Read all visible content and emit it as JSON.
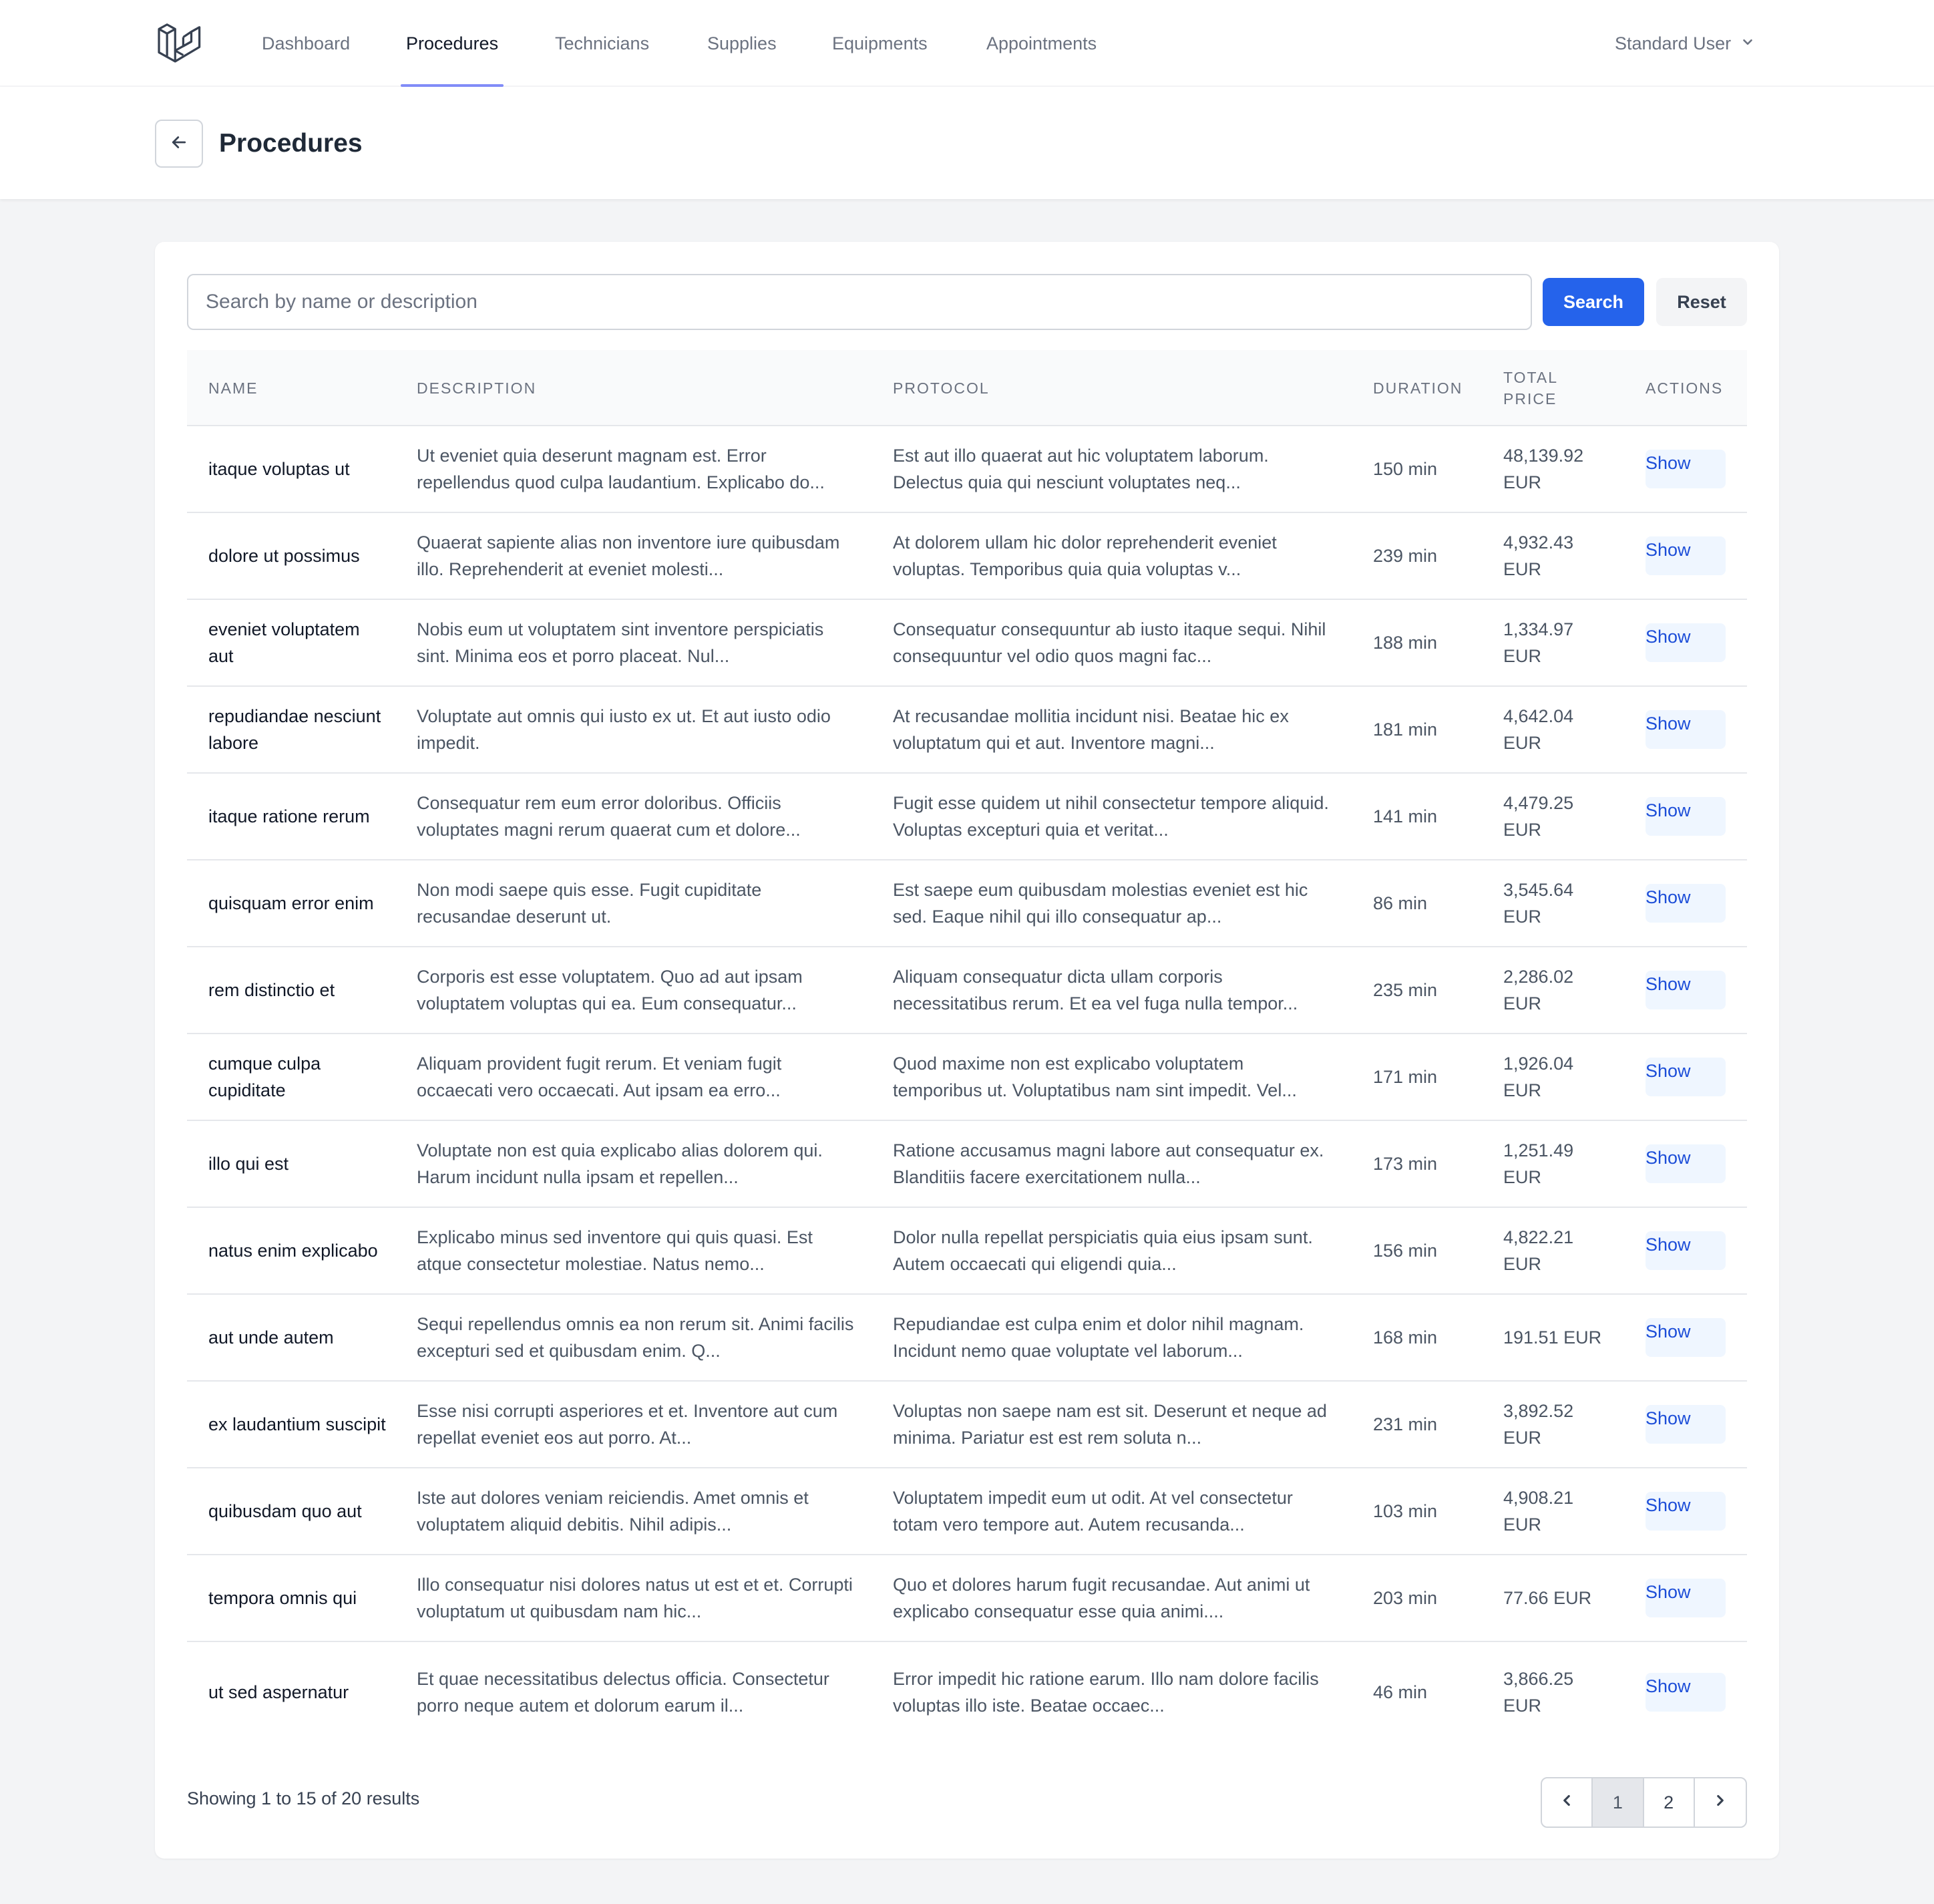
{
  "nav": {
    "items": [
      {
        "label": "Dashboard"
      },
      {
        "label": "Procedures",
        "active": true
      },
      {
        "label": "Technicians"
      },
      {
        "label": "Supplies"
      },
      {
        "label": "Equipments"
      },
      {
        "label": "Appointments"
      }
    ],
    "user_label": "Standard User"
  },
  "header": {
    "title": "Procedures"
  },
  "search": {
    "placeholder": "Search by name or description",
    "value": "",
    "search_label": "Search",
    "reset_label": "Reset"
  },
  "table": {
    "columns": {
      "name": "Name",
      "description": "Description",
      "protocol": "Protocol",
      "duration": "Duration",
      "total_price": "Total Price",
      "actions": "Actions"
    },
    "action_label": "Show",
    "rows": [
      {
        "name": "itaque voluptas ut",
        "description": "Ut eveniet quia deserunt magnam est. Error repellendus quod culpa laudantium. Explicabo do...",
        "protocol": "Est aut illo quaerat aut hic voluptatem laborum. Delectus quia qui nesciunt voluptates neq...",
        "duration": "150 min",
        "price": "48,139.92 EUR"
      },
      {
        "name": "dolore ut possimus",
        "description": "Quaerat sapiente alias non inventore iure quibusdam illo. Reprehenderit at eveniet molesti...",
        "protocol": "At dolorem ullam hic dolor reprehenderit eveniet voluptas. Temporibus quia quia voluptas v...",
        "duration": "239 min",
        "price": "4,932.43 EUR"
      },
      {
        "name": "eveniet voluptatem aut",
        "description": "Nobis eum ut voluptatem sint inventore perspiciatis sint. Minima eos et porro placeat. Nul...",
        "protocol": "Consequatur consequuntur ab iusto itaque sequi. Nihil consequuntur vel odio quos magni fac...",
        "duration": "188 min",
        "price": "1,334.97 EUR"
      },
      {
        "name": "repudiandae nesciunt labore",
        "description": "Voluptate aut omnis qui iusto ex ut. Et aut iusto odio impedit.",
        "protocol": "At recusandae mollitia incidunt nisi. Beatae hic ex voluptatum qui et aut. Inventore magni...",
        "duration": "181 min",
        "price": "4,642.04 EUR"
      },
      {
        "name": "itaque ratione rerum",
        "description": "Consequatur rem eum error doloribus. Officiis voluptates magni rerum quaerat cum et dolore...",
        "protocol": "Fugit esse quidem ut nihil consectetur tempore aliquid. Voluptas excepturi quia et veritat...",
        "duration": "141 min",
        "price": "4,479.25 EUR"
      },
      {
        "name": "quisquam error enim",
        "description": "Non modi saepe quis esse. Fugit cupiditate recusandae deserunt ut.",
        "protocol": "Est saepe eum quibusdam molestias eveniet est hic sed. Eaque nihil qui illo consequatur ap...",
        "duration": "86 min",
        "price": "3,545.64 EUR"
      },
      {
        "name": "rem distinctio et",
        "description": "Corporis est esse voluptatem. Quo ad aut ipsam voluptatem voluptas qui ea. Eum consequatur...",
        "protocol": "Aliquam consequatur dicta ullam corporis necessitatibus rerum. Et ea vel fuga nulla tempor...",
        "duration": "235 min",
        "price": "2,286.02 EUR"
      },
      {
        "name": "cumque culpa cupiditate",
        "description": "Aliquam provident fugit rerum. Et veniam fugit occaecati vero occaecati. Aut ipsam ea erro...",
        "protocol": "Quod maxime non est explicabo voluptatem temporibus ut. Voluptatibus nam sint impedit. Vel...",
        "duration": "171 min",
        "price": "1,926.04 EUR"
      },
      {
        "name": "illo qui est",
        "description": "Voluptate non est quia explicabo alias dolorem qui. Harum incidunt nulla ipsam et repellen...",
        "protocol": "Ratione accusamus magni labore aut consequatur ex. Blanditiis facere exercitationem nulla...",
        "duration": "173 min",
        "price": "1,251.49 EUR"
      },
      {
        "name": "natus enim explicabo",
        "description": "Explicabo minus sed inventore qui quis quasi. Est atque consectetur molestiae. Natus nemo...",
        "protocol": "Dolor nulla repellat perspiciatis quia eius ipsam sunt. Autem occaecati qui eligendi quia...",
        "duration": "156 min",
        "price": "4,822.21 EUR"
      },
      {
        "name": "aut unde autem",
        "description": "Sequi repellendus omnis ea non rerum sit. Animi facilis excepturi sed et quibusdam enim. Q...",
        "protocol": "Repudiandae est culpa enim et dolor nihil magnam. Incidunt nemo quae voluptate vel laborum...",
        "duration": "168 min",
        "price": "191.51 EUR"
      },
      {
        "name": "ex laudantium suscipit",
        "description": "Esse nisi corrupti asperiores et et. Inventore aut cum repellat eveniet eos aut porro. At...",
        "protocol": "Voluptas non saepe nam est sit. Deserunt et neque ad minima. Pariatur est est rem soluta n...",
        "duration": "231 min",
        "price": "3,892.52 EUR"
      },
      {
        "name": "quibusdam quo aut",
        "description": "Iste aut dolores veniam reiciendis. Amet omnis et voluptatem aliquid debitis. Nihil adipis...",
        "protocol": "Voluptatem impedit eum ut odit. At vel consectetur totam vero tempore aut. Autem recusanda...",
        "duration": "103 min",
        "price": "4,908.21 EUR"
      },
      {
        "name": "tempora omnis qui",
        "description": "Illo consequatur nisi dolores natus ut est et et. Corrupti voluptatum ut quibusdam nam hic...",
        "protocol": "Quo et dolores harum fugit recusandae. Aut animi ut explicabo consequatur esse quia animi....",
        "duration": "203 min",
        "price": "77.66 EUR"
      },
      {
        "name": "ut sed aspernatur",
        "description": "Et quae necessitatibus delectus officia. Consectetur porro neque autem et dolorum earum il...",
        "protocol": "Error impedit hic ratione earum. Illo nam dolore facilis voluptas illo iste. Beatae occaec...",
        "duration": "46 min",
        "price": "3,866.25 EUR"
      }
    ]
  },
  "pagination": {
    "summary": "Showing 1 to 15 of 20 results",
    "pages": [
      "1",
      "2"
    ],
    "current_page": "1"
  },
  "colors": {
    "primary": "#2563eb",
    "nav_active_underline": "#818cf8",
    "show_button_bg": "#eff6ff",
    "show_button_text": "#1d4ed8",
    "page_background": "#f3f4f6"
  },
  "icons": {
    "logo": "laravel-logo-icon",
    "back": "arrow-left-icon",
    "user_menu": "chevron-down-icon",
    "prev": "chevron-left-icon",
    "next": "chevron-right-icon"
  }
}
